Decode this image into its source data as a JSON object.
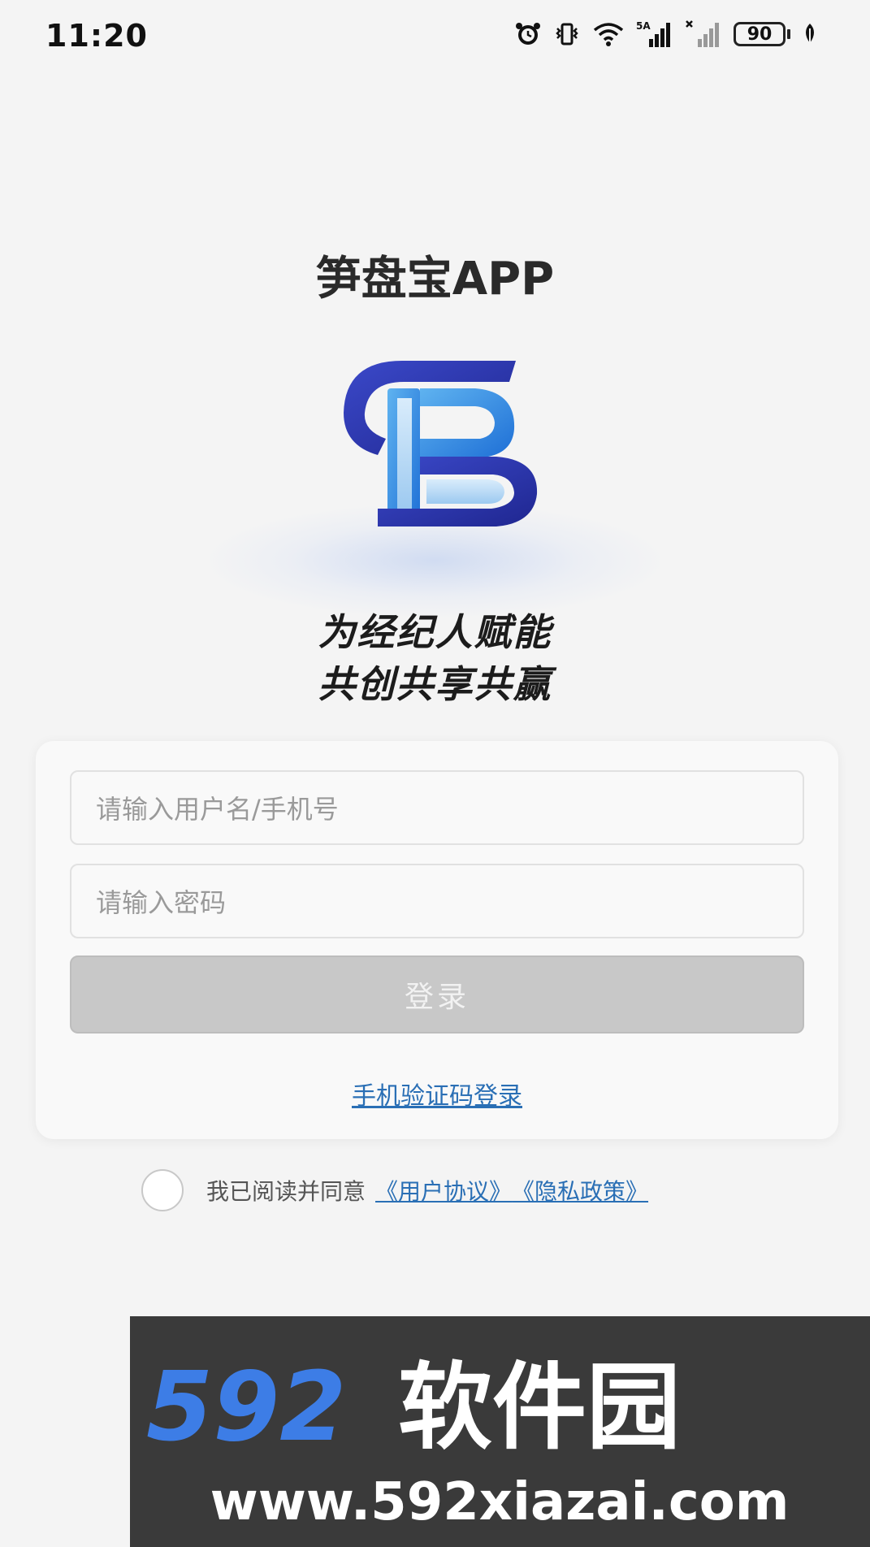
{
  "status_bar": {
    "time": "11:20",
    "battery": "90",
    "icons": [
      "alarm-icon",
      "vibrate-icon",
      "wifi-icon",
      "signal-5a-icon",
      "signal-no-service-icon",
      "battery-icon",
      "leaf-icon"
    ],
    "network_label": "5A"
  },
  "header": {
    "app_title": "笋盘宝APP",
    "logo_icon": "sb-logo-icon",
    "slogan_line1": "为经纪人赋能",
    "slogan_line2": "共创共享共赢"
  },
  "login_form": {
    "username_placeholder": "请输入用户名/手机号",
    "password_placeholder": "请输入密码",
    "login_button_label": "登录",
    "sms_login_link": "手机验证码登录"
  },
  "agreement": {
    "text": "我已阅读并同意",
    "user_agreement": "《用户协议》",
    "privacy_policy": "《隐私政策》"
  },
  "watermark": {
    "brand": "592软件园",
    "url": "www.592xiazai.com"
  },
  "colors": {
    "background": "#f4f4f4",
    "link": "#2a6fb5",
    "button_disabled": "#c8c8c8",
    "logo_blue": "#2b6fd8",
    "logo_navy": "#2a2f9e",
    "watermark_brand": "#3d7de6"
  }
}
